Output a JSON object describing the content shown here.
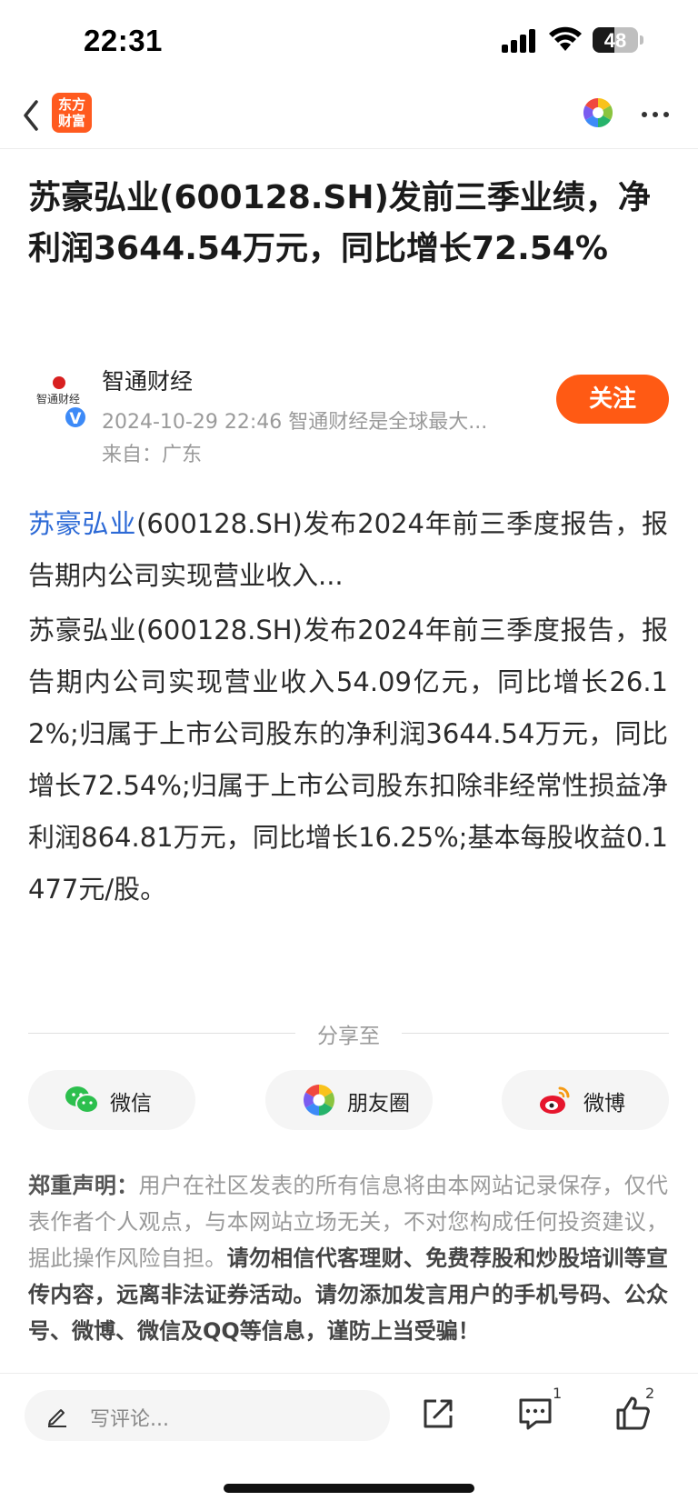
{
  "status_bar": {
    "time": "22:31",
    "battery_level": "48",
    "battery_fraction": 0.48
  },
  "nav": {
    "back_icon": "chevron-left-icon",
    "app_logo_line1": "东方",
    "app_logo_line2": "财富",
    "app_logo_color": "#ff5a1f",
    "moments_icon": "moments-icon",
    "more_icon": "ellipsis-icon"
  },
  "article": {
    "title": "苏豪弘业(600128.SH)发前三季业绩，净利润3644.54万元，同比增长72.54%",
    "author": {
      "name": "智通财经",
      "avatar_text": "智通财经",
      "verified": "V",
      "meta": "2024-10-29 22:46 智通财经是全球最大...",
      "location": "来自：广东",
      "follow_label": "关注",
      "follow_color": "#ff5a14"
    },
    "summary_link": "苏豪弘业",
    "summary_rest": "(600128.SH)发布2024年前三季度报告，报告期内公司实现营业收入...",
    "full_text": "苏豪弘业(600128.SH)发布2024年前三季度报告，报告期内公司实现营业收入54.09亿元，同比增长26.12%;归属于上市公司股东的净利润3644.54万元，同比增长72.54%;归属于上市公司股东扣除非经常性损益净利润864.81万元，同比增长16.25%;基本每股收益0.1477元/股。",
    "link_color": "#2d6ad6"
  },
  "share": {
    "label": "分享至",
    "options": [
      {
        "label": "微信",
        "icon": "wechat-icon"
      },
      {
        "label": "朋友圈",
        "icon": "moments-icon"
      },
      {
        "label": "微博",
        "icon": "weibo-icon"
      }
    ]
  },
  "disclaimer": {
    "title": "郑重声明：",
    "normal": "用户在社区发表的所有信息将由本网站记录保存，仅代表作者个人观点，与本网站立场无关，不对您构成任何投资建议，据此操作风险自担。",
    "strong": "请勿相信代客理财、免费荐股和炒股培训等宣传内容，远离非法证券活动。请勿添加发言用户的手机号码、公众号、微博、微信及QQ等信息，谨防上当受骗！"
  },
  "bottom_bar": {
    "comment_placeholder": "写评论...",
    "comment_count": "1",
    "like_count": "2",
    "icons": [
      "pencil-icon",
      "share-out-icon",
      "comment-icon",
      "thumbs-up-icon"
    ]
  }
}
